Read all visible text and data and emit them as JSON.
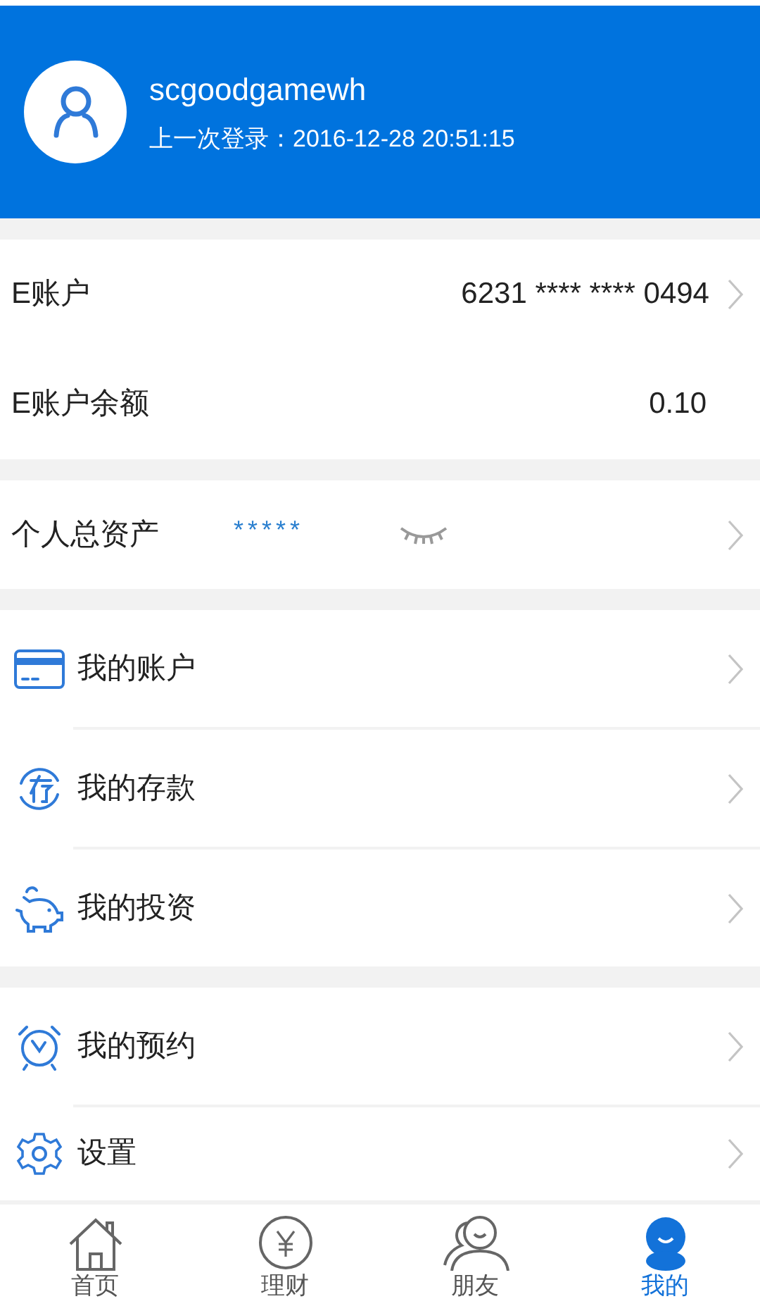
{
  "profile": {
    "username": "scgoodgamewh",
    "last_login": "上一次登录：2016-12-28 20:51:15"
  },
  "account": [
    {
      "label": "E账户",
      "value": "6231 **** **** 0494",
      "chevron": true
    },
    {
      "label": "E账户余额",
      "value": "0.10",
      "chevron": false
    }
  ],
  "assets": {
    "label": "个人总资产",
    "value": "*****",
    "hidden": true
  },
  "menu_groups": [
    [
      {
        "kind": "card",
        "label": "我的账户"
      },
      {
        "kind": "deposit",
        "label": "我的存款"
      },
      {
        "kind": "piggy",
        "label": "我的投资"
      }
    ],
    [
      {
        "kind": "alarm",
        "label": "我的预约"
      },
      {
        "kind": "gear",
        "label": "设置"
      }
    ]
  ],
  "tabs": [
    {
      "kind": "home",
      "label": "首页",
      "selected": false
    },
    {
      "kind": "finance",
      "label": "理财",
      "selected": false
    },
    {
      "kind": "friends",
      "label": "朋友",
      "selected": false
    },
    {
      "kind": "me",
      "label": "我的",
      "selected": true
    }
  ]
}
